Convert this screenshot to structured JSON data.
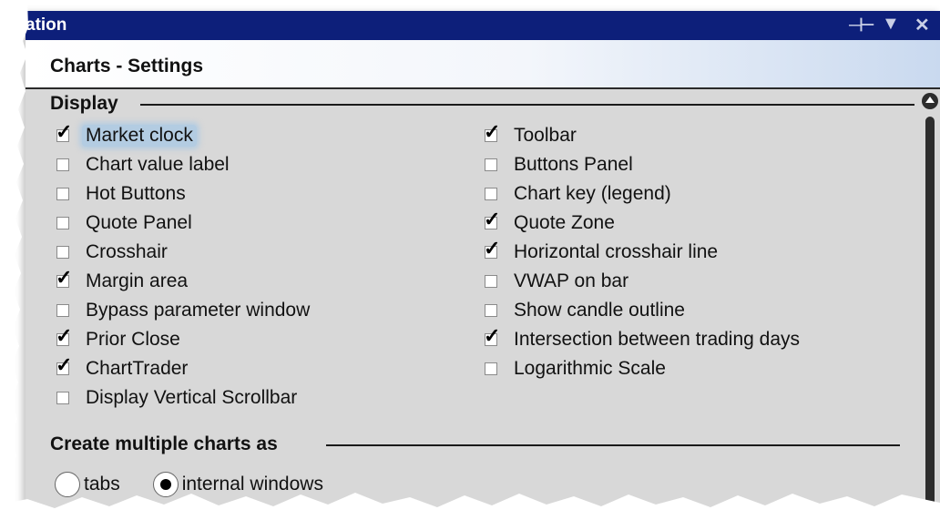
{
  "window": {
    "title": "ation"
  },
  "header": {
    "title": "Charts - Settings"
  },
  "display_section": {
    "title": "Display",
    "left_items": [
      {
        "label": "Market clock",
        "checked": true
      },
      {
        "label": "Chart value label",
        "checked": false
      },
      {
        "label": "Hot Buttons",
        "checked": false
      },
      {
        "label": "Quote Panel",
        "checked": false
      },
      {
        "label": "Crosshair",
        "checked": false
      },
      {
        "label": "Margin area",
        "checked": true
      },
      {
        "label": "Bypass parameter window",
        "checked": false
      },
      {
        "label": "Prior Close",
        "checked": true
      },
      {
        "label": "ChartTrader",
        "checked": true
      },
      {
        "label": "Display Vertical Scrollbar",
        "checked": false
      }
    ],
    "right_items": [
      {
        "label": "Toolbar",
        "checked": true
      },
      {
        "label": "Buttons Panel",
        "checked": false
      },
      {
        "label": "Chart key (legend)",
        "checked": false
      },
      {
        "label": "Quote Zone",
        "checked": true
      },
      {
        "label": "Horizontal crosshair line",
        "checked": true
      },
      {
        "label": "VWAP on bar",
        "checked": false
      },
      {
        "label": "Show candle outline",
        "checked": false
      },
      {
        "label": "Intersection between trading days",
        "checked": true
      },
      {
        "label": "Logarithmic Scale",
        "checked": false
      }
    ]
  },
  "multiple_section": {
    "title": "Create multiple charts as",
    "options": [
      {
        "label": "tabs",
        "selected": false
      },
      {
        "label": "internal windows",
        "selected": true
      }
    ]
  },
  "icons": {
    "pin": "pin-icon",
    "dropdown": "dropdown-icon",
    "close": "close-icon",
    "check": "check-icon"
  }
}
